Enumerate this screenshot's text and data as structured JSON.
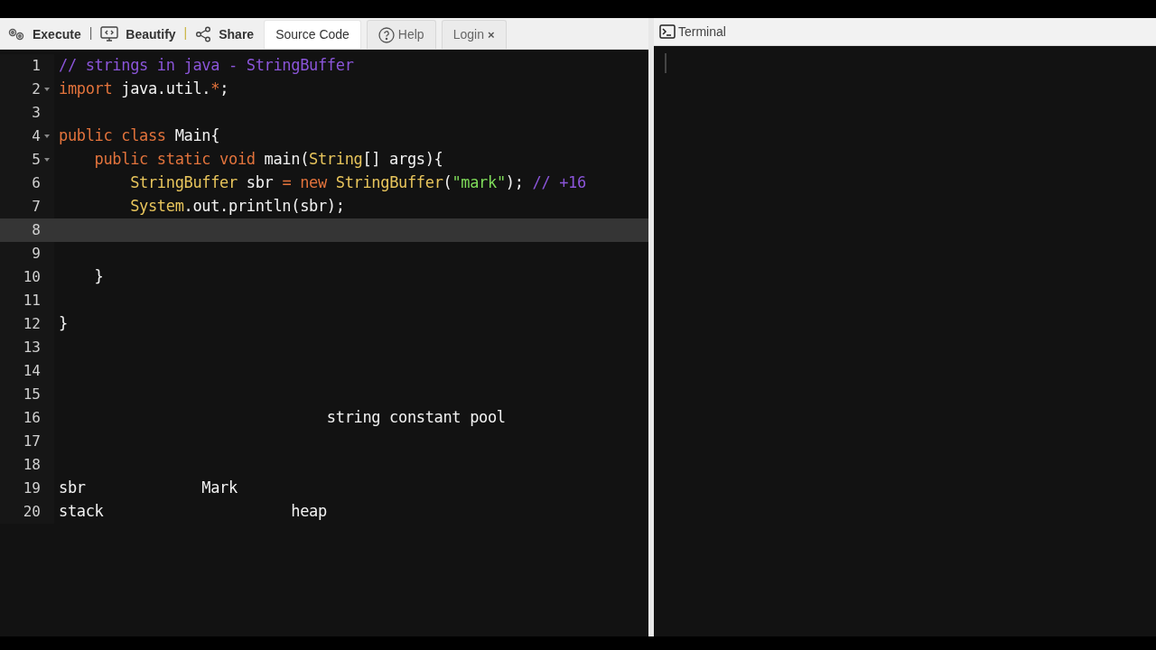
{
  "toolbar": {
    "actions": [
      {
        "kind": "execute",
        "label": "Execute"
      },
      {
        "kind": "beautify",
        "label": "Beautify"
      },
      {
        "kind": "share",
        "label": "Share"
      }
    ],
    "separators": [
      "|",
      "|"
    ],
    "tabs": [
      {
        "kind": "plain",
        "label": "Source Code",
        "selected": true
      },
      {
        "kind": "help",
        "label": "Help",
        "selected": false
      },
      {
        "kind": "login",
        "label": "Login",
        "close": "×",
        "selected": false
      }
    ]
  },
  "editor": {
    "lines": [
      {
        "number": "1",
        "foldable": false,
        "active": false,
        "tokens": [
          {
            "kind": "comment",
            "text": "// strings in java - StringBuffer"
          }
        ]
      },
      {
        "number": "2",
        "foldable": true,
        "active": false,
        "tokens": [
          {
            "kind": "keyword",
            "text": "import"
          },
          {
            "kind": "plain",
            "text": " java.util."
          },
          {
            "kind": "operator",
            "text": "*"
          },
          {
            "kind": "plain",
            "text": ";"
          }
        ]
      },
      {
        "number": "3",
        "foldable": false,
        "active": false
      },
      {
        "number": "4",
        "foldable": true,
        "active": false,
        "tokens": [
          {
            "kind": "keyword",
            "text": "public class"
          },
          {
            "kind": "plain",
            "text": " Main{"
          }
        ]
      },
      {
        "number": "5",
        "foldable": true,
        "active": false,
        "tokens": [
          {
            "kind": "keyword",
            "text": "    public static void"
          },
          {
            "kind": "plain",
            "text": " main("
          },
          {
            "kind": "type",
            "text": "String"
          },
          {
            "kind": "plain",
            "text": "[] args){"
          }
        ]
      },
      {
        "number": "6",
        "foldable": false,
        "active": false,
        "tokens": [
          {
            "kind": "type",
            "text": "        StringBuffer"
          },
          {
            "kind": "plain",
            "text": " sbr "
          },
          {
            "kind": "operator",
            "text": "="
          },
          {
            "kind": "keyword",
            "text": " new"
          },
          {
            "kind": "type",
            "text": " StringBuffer"
          },
          {
            "kind": "plain",
            "text": "("
          },
          {
            "kind": "string",
            "text": "\"mark\""
          },
          {
            "kind": "plain",
            "text": "); "
          },
          {
            "kind": "comment",
            "text": "// +16"
          }
        ]
      },
      {
        "number": "7",
        "foldable": false,
        "active": false,
        "tokens": [
          {
            "kind": "type",
            "text": "        System"
          },
          {
            "kind": "plain",
            "text": ".out.println(sbr);"
          }
        ]
      },
      {
        "number": "8",
        "foldable": false,
        "active": true
      },
      {
        "number": "9",
        "foldable": false,
        "active": false
      },
      {
        "number": "10",
        "foldable": false,
        "active": false,
        "tokens": [
          {
            "kind": "plain",
            "text": "    }"
          }
        ]
      },
      {
        "number": "11",
        "foldable": false,
        "active": false
      },
      {
        "number": "12",
        "foldable": false,
        "active": false,
        "tokens": [
          {
            "kind": "plain",
            "text": "}"
          }
        ]
      },
      {
        "number": "13",
        "foldable": false,
        "active": false
      },
      {
        "number": "14",
        "foldable": false,
        "active": false
      },
      {
        "number": "15",
        "foldable": false,
        "active": false
      },
      {
        "number": "16",
        "foldable": false,
        "active": false,
        "tokens": [
          {
            "kind": "plain",
            "text": "                              string constant pool"
          }
        ]
      },
      {
        "number": "17",
        "foldable": false,
        "active": false
      },
      {
        "number": "18",
        "foldable": false,
        "active": false
      },
      {
        "number": "19",
        "foldable": false,
        "active": false,
        "tokens": [
          {
            "kind": "plain",
            "text": "sbr             Mark"
          }
        ]
      },
      {
        "number": "20",
        "foldable": false,
        "active": false,
        "tokens": [
          {
            "kind": "plain",
            "text": "stack                     heap"
          }
        ]
      }
    ]
  },
  "terminal": {
    "title": "Terminal"
  }
}
